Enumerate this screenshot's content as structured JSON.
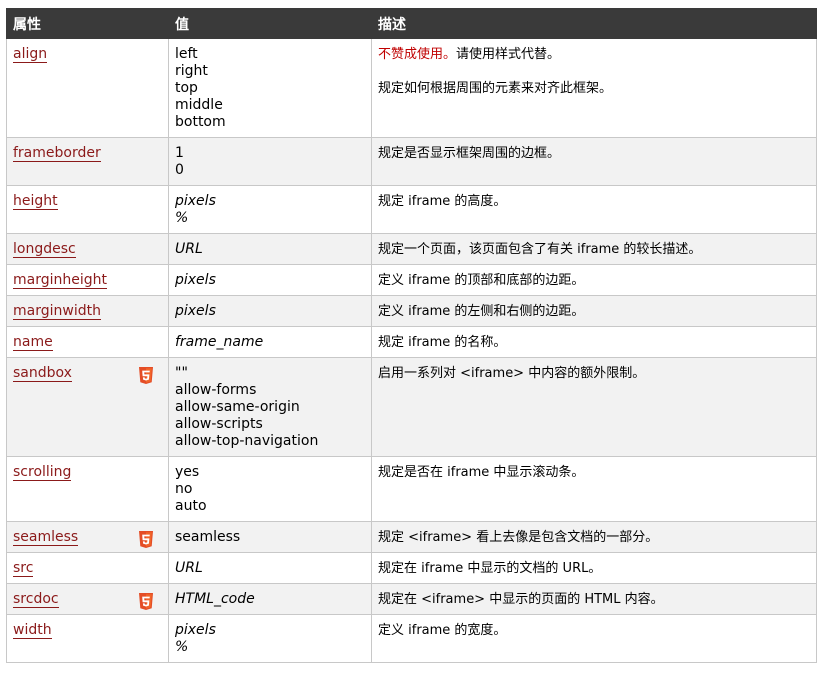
{
  "table": {
    "headers": [
      "属性",
      "值",
      "描述"
    ],
    "rows": [
      {
        "attr": "align",
        "values": [
          "left",
          "right",
          "top",
          "middle",
          "bottom"
        ],
        "italic": false,
        "html5": false,
        "desc_warning": "不赞成使用。",
        "desc_warning_rest": "请使用样式代替。",
        "desc": "规定如何根据周围的元素来对齐此框架。"
      },
      {
        "attr": "frameborder",
        "values": [
          "1",
          "0"
        ],
        "italic": false,
        "html5": false,
        "desc": "规定是否显示框架周围的边框。"
      },
      {
        "attr": "height",
        "values": [
          "pixels",
          "%"
        ],
        "italic": true,
        "html5": false,
        "desc": "规定 iframe 的高度。"
      },
      {
        "attr": "longdesc",
        "values": [
          "URL"
        ],
        "italic": true,
        "html5": false,
        "desc": "规定一个页面，该页面包含了有关 iframe 的较长描述。"
      },
      {
        "attr": "marginheight",
        "values": [
          "pixels"
        ],
        "italic": true,
        "html5": false,
        "desc": "定义 iframe 的顶部和底部的边距。"
      },
      {
        "attr": "marginwidth",
        "values": [
          "pixels"
        ],
        "italic": true,
        "html5": false,
        "desc": "定义 iframe 的左侧和右侧的边距。"
      },
      {
        "attr": "name",
        "values": [
          "frame_name"
        ],
        "italic": true,
        "html5": false,
        "desc": "规定 iframe 的名称。"
      },
      {
        "attr": "sandbox",
        "values": [
          "\"\"",
          "allow-forms",
          "allow-same-origin",
          "allow-scripts",
          "allow-top-navigation"
        ],
        "italic": false,
        "html5": true,
        "desc": "启用一系列对 <iframe> 中内容的额外限制。"
      },
      {
        "attr": "scrolling",
        "values": [
          "yes",
          "no",
          "auto"
        ],
        "italic": false,
        "html5": false,
        "desc": "规定是否在 iframe 中显示滚动条。"
      },
      {
        "attr": "seamless",
        "values": [
          "seamless"
        ],
        "italic": false,
        "html5": true,
        "desc": "规定 <iframe> 看上去像是包含文档的一部分。"
      },
      {
        "attr": "src",
        "values": [
          "URL"
        ],
        "italic": true,
        "html5": false,
        "desc": "规定在 iframe 中显示的文档的 URL。"
      },
      {
        "attr": "srcdoc",
        "values": [
          "HTML_code"
        ],
        "italic": true,
        "html5": true,
        "desc": "规定在 <iframe> 中显示的页面的 HTML 内容。"
      },
      {
        "attr": "width",
        "values": [
          "pixels",
          "%"
        ],
        "italic": true,
        "html5": false,
        "desc": "定义 iframe 的宽度。"
      }
    ]
  },
  "colors": {
    "header_bg": "#3a3a3a",
    "link": "#8b1a1a",
    "warning": "#c00000",
    "html5_badge": "#e44d26"
  },
  "icons": {
    "html5_badge": "html5-icon"
  }
}
